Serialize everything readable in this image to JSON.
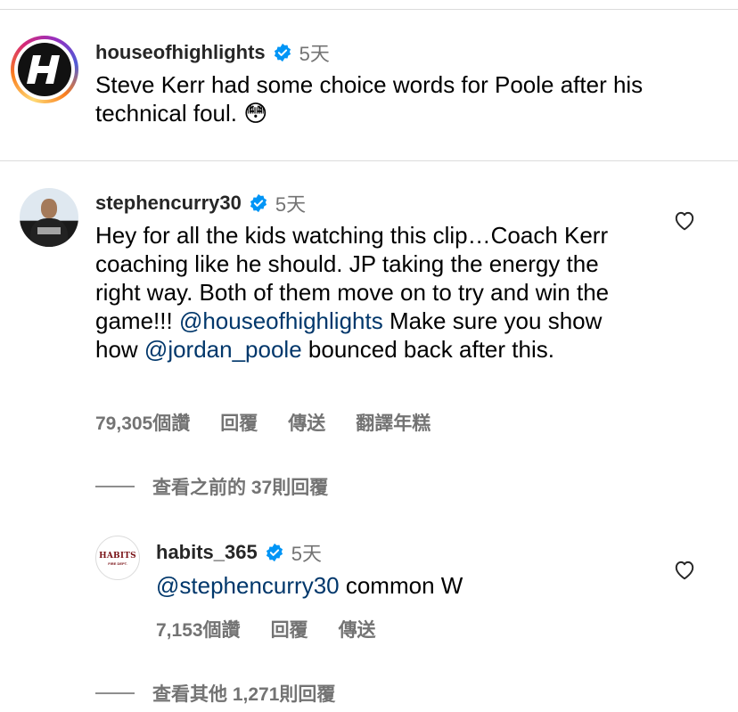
{
  "post": {
    "username": "houseofhighlights",
    "time": "5天",
    "caption": "Steve Kerr had some choice words for Poole after his technical foul. 😳"
  },
  "comment": {
    "username": "stephencurry30",
    "time": "5天",
    "text_1": "Hey for all the kids watching this clip…Coach Kerr coaching like he should. JP taking the energy the right way. Both of them move on to try and win the game!!! ",
    "mention_1": "@houseofhighlights",
    "text_2": " Make sure you show how ",
    "mention_2": "@jordan_poole",
    "text_3": " bounced back after this.",
    "likes": "79,305個讚",
    "reply_label": "回覆",
    "share_label": "傳送",
    "translate_label": "翻譯年糕",
    "view_previous": "查看之前的 37則回覆"
  },
  "reply": {
    "username": "habits_365",
    "time": "5天",
    "avatar_text": "HABITS",
    "avatar_subtext": "FIRE DEPT.",
    "mention": "@stephencurry30",
    "text": " common W",
    "likes": "7,153個讚",
    "reply_label": "回覆",
    "share_label": "傳送",
    "view_other": "查看其他 1,271則回覆"
  },
  "colors": {
    "verified_blue": "#0095f6",
    "mention_blue": "#00376b",
    "secondary_text": "#737373"
  }
}
